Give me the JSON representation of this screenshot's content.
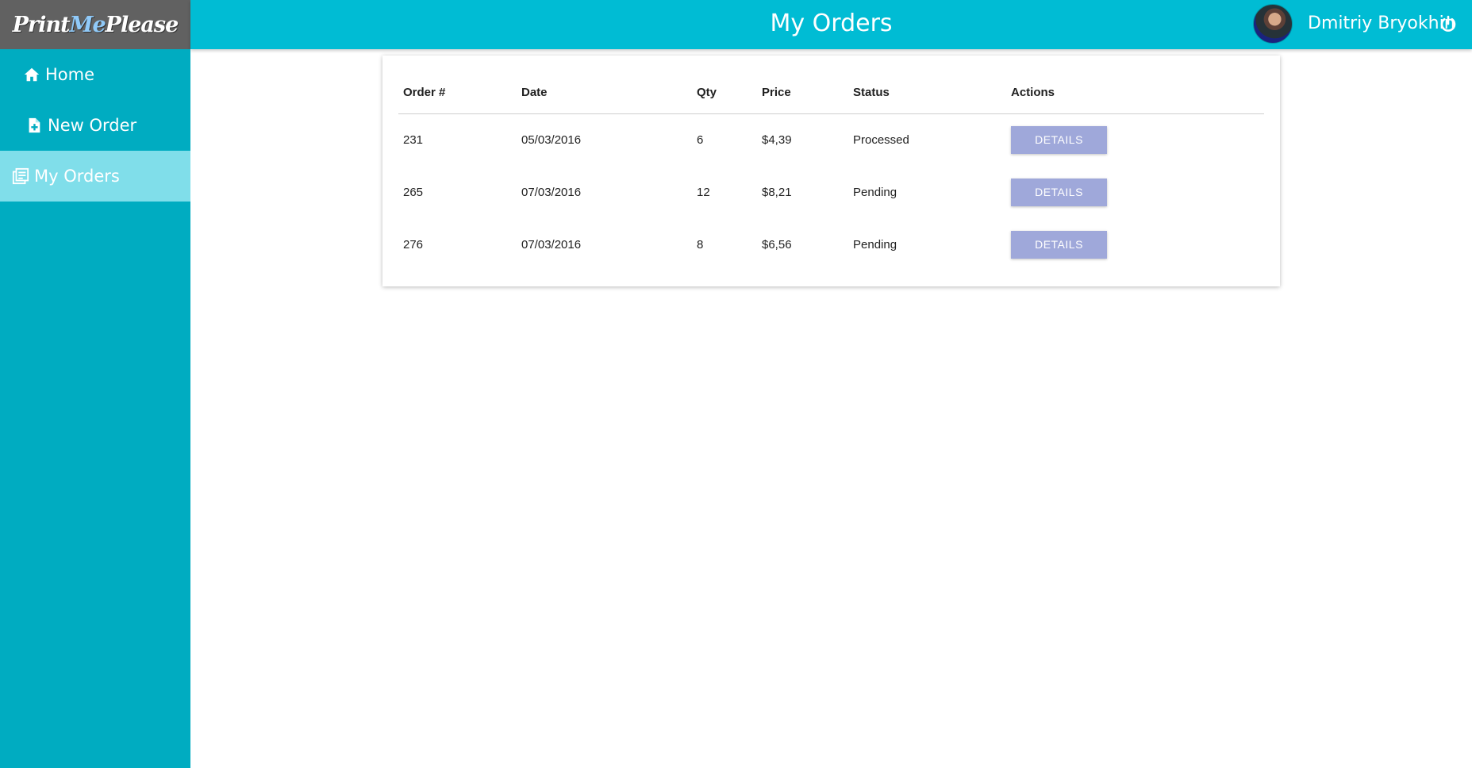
{
  "app": {
    "logo_part1": "Print",
    "logo_part2": "Me",
    "logo_part3": "Please"
  },
  "header": {
    "title": "My Orders",
    "user_name": "Dmitriy Bryokhin"
  },
  "sidebar": {
    "items": [
      {
        "label": "Home",
        "icon": "home-icon"
      },
      {
        "label": "New Order",
        "icon": "new-file-icon"
      },
      {
        "label": "My Orders",
        "icon": "orders-list-icon",
        "active": true
      }
    ]
  },
  "orders_table": {
    "headers": [
      "Order #",
      "Date",
      "Qty",
      "Price",
      "Status",
      "Actions"
    ],
    "rows": [
      {
        "order": "231",
        "date": "05/03/2016",
        "qty": "6",
        "price": "$4,39",
        "status": "Processed",
        "action": "DETAILS"
      },
      {
        "order": "265",
        "date": "07/03/2016",
        "qty": "12",
        "price": "$8,21",
        "status": "Pending",
        "action": "DETAILS"
      },
      {
        "order": "276",
        "date": "07/03/2016",
        "qty": "8",
        "price": "$6,56",
        "status": "Pending",
        "action": "DETAILS"
      }
    ]
  },
  "colors": {
    "header_bg": "#00bcd4",
    "sidebar_bg": "#00acc1",
    "sidebar_active_bg": "#80deea",
    "logo_bg": "#616161",
    "button_bg": "#9fa8da"
  }
}
